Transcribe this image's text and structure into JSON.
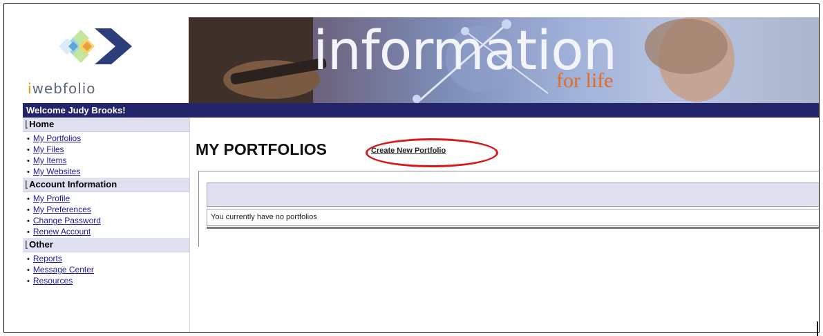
{
  "header": {
    "logo_prefix": "i",
    "logo_rest": "webfolio",
    "banner_word": "information",
    "banner_sub": "for life",
    "welcome": "Welcome Judy Brooks!"
  },
  "sidebar": {
    "sections": [
      {
        "title": "Home",
        "items": [
          "My Portfolios",
          "My Files",
          "My Items",
          "My Websites"
        ]
      },
      {
        "title": "Account Information",
        "items": [
          "My Profile",
          "My Preferences",
          "Change Password",
          "Renew Account"
        ]
      },
      {
        "title": "Other",
        "items": [
          "Reports",
          "Message Center",
          "Resources"
        ]
      }
    ]
  },
  "main": {
    "title": "MY PORTFOLIOS",
    "create_link": "Create New Portfolio",
    "empty_message": "You currently have no portfolios"
  },
  "colors": {
    "welcome_bar": "#24246a",
    "section_bg": "#dfe0f0",
    "highlight": "#d81818",
    "logo_accent": "#e88a1a"
  }
}
